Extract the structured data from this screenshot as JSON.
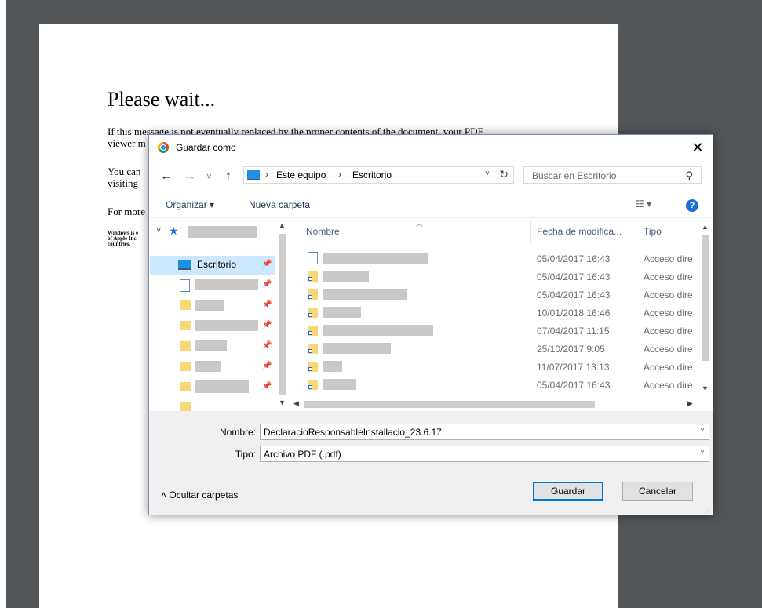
{
  "pdf": {
    "title": "Please wait...",
    "line1": "If this message is not eventually replaced by the proper contents of the document, your PDF",
    "line2": "viewer m",
    "line3": "You can",
    "line4": "visiting",
    "line5": "For more",
    "small1": "Windows is e",
    "small2": "of Apple Inc.",
    "small3": "countries."
  },
  "dialog": {
    "title": "Guardar como",
    "close_label": "✕",
    "nav": {
      "back": "←",
      "forward": "→",
      "recent": "˅",
      "up": "↑"
    },
    "breadcrumb": [
      "Este equipo",
      "Escritorio"
    ],
    "breadcrumb_sep": "›",
    "search_placeholder": "Buscar en Escritorio",
    "toolbar": {
      "organize": "Organizar ▾",
      "new_folder": "Nueva carpeta"
    },
    "nav_pane": {
      "selected": "Escritorio"
    },
    "columns": {
      "name": "Nombre",
      "date": "Fecha de modifica...",
      "type": "Tipo"
    },
    "files": [
      {
        "date": "05/04/2017 16:43",
        "type": "Acceso dire"
      },
      {
        "date": "05/04/2017 16:43",
        "type": "Acceso dire"
      },
      {
        "date": "05/04/2017 16:43",
        "type": "Acceso dire"
      },
      {
        "date": "10/01/2018 16:46",
        "type": "Acceso dire"
      },
      {
        "date": "07/04/2017 11:15",
        "type": "Acceso dire"
      },
      {
        "date": "25/10/2017 9:05",
        "type": "Acceso dire"
      },
      {
        "date": "11/07/2017 13:13",
        "type": "Acceso dire"
      },
      {
        "date": "05/04/2017 16:43",
        "type": "Acceso dire"
      }
    ],
    "filename_label": "Nombre:",
    "filename_value": "DeclaracioResponsableInstallacio_23.6.17",
    "filetype_label": "Tipo:",
    "filetype_value": "Archivo PDF (.pdf)",
    "hide_folders": "Ocultar carpetas",
    "save_button": "Guardar",
    "cancel_button": "Cancelar"
  },
  "colors": {
    "viewer_background": "#525659",
    "selection": "#cce8ff",
    "accent": "#0078d7",
    "folder": "#f8d775"
  }
}
